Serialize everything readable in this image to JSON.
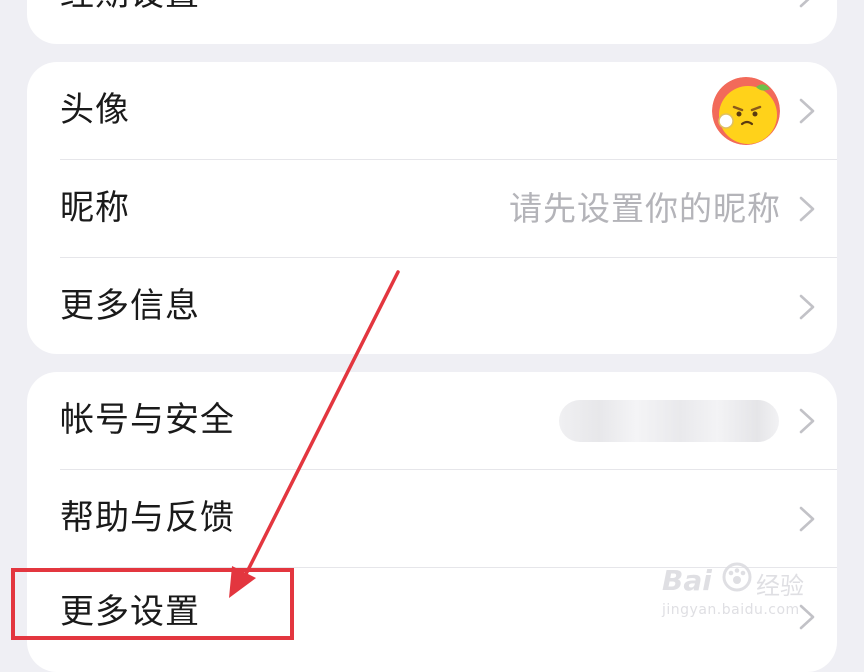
{
  "cards": {
    "top_partial": {
      "label": "经期设置"
    },
    "profile": {
      "rows": [
        {
          "label": "头像"
        },
        {
          "label": "昵称",
          "value": "请先设置你的昵称"
        },
        {
          "label": "更多信息"
        }
      ]
    },
    "settings": {
      "rows": [
        {
          "label": "帐号与安全"
        },
        {
          "label": "帮助与反馈"
        },
        {
          "label": "更多设置"
        }
      ]
    }
  },
  "watermark": {
    "brand": "Bai",
    "brand_cn": "经验",
    "url": "jingyan.baidu.com"
  },
  "colors": {
    "background": "#efeff4",
    "card": "#ffffff",
    "text": "#1a1a1a",
    "secondary_text": "#b4b4b9",
    "annotation": "#e3363f"
  },
  "icons": {
    "chevron": "chevron-right-icon",
    "avatar": "orange-cartoon-avatar",
    "annotation_arrow": "red-arrow-annotation",
    "annotation_box": "red-highlight-box"
  }
}
